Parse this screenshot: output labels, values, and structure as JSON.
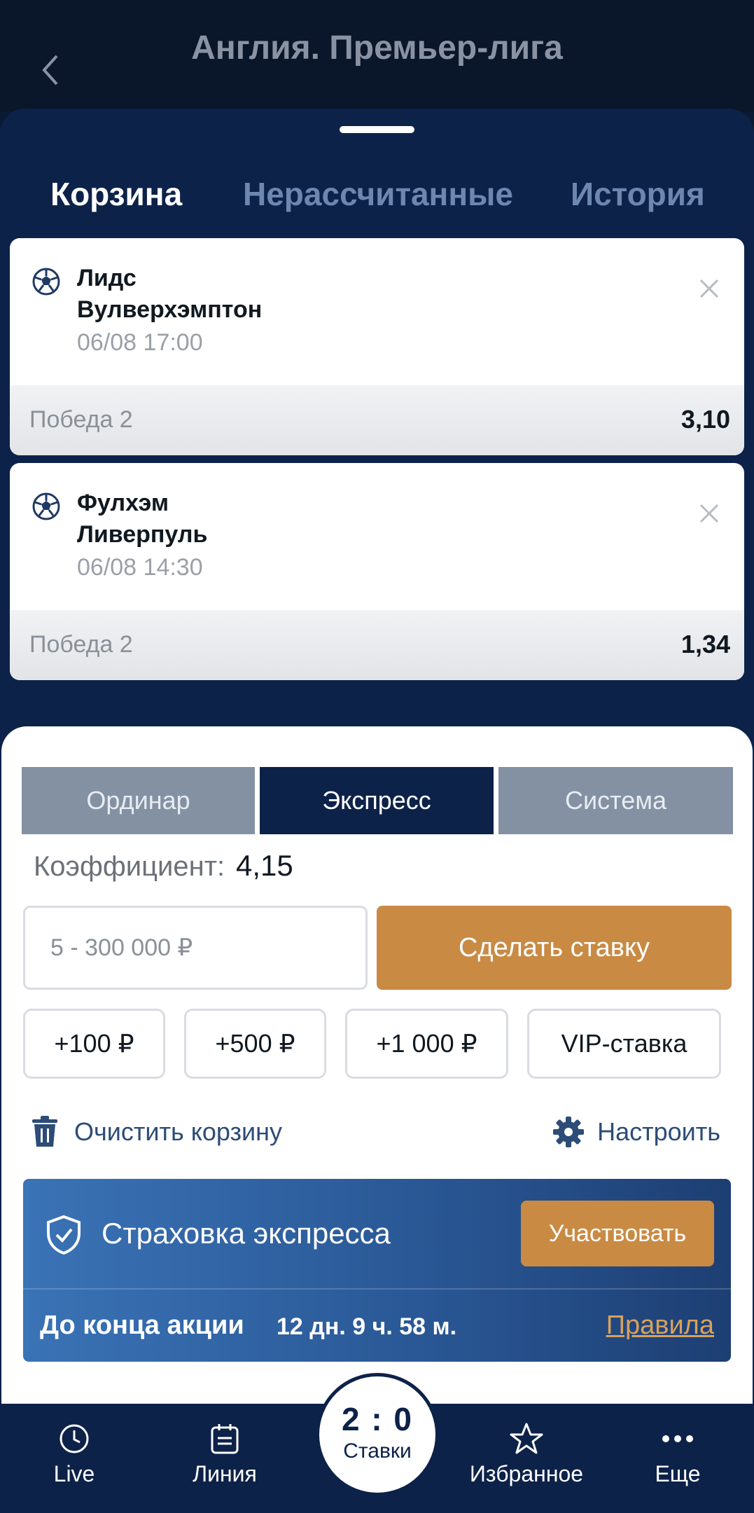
{
  "header": {
    "title": "Англия. Премьер-лига"
  },
  "tabs": [
    {
      "label": "Корзина",
      "active": true
    },
    {
      "label": "Нерассчитанные",
      "active": false
    },
    {
      "label": "История",
      "active": false
    }
  ],
  "bets": [
    {
      "team1": "Лидс",
      "team2": "Вулверхэмптон",
      "datetime": "06/08 17:00",
      "outcome": "Победа 2",
      "odds": "3,10"
    },
    {
      "team1": "Фулхэм",
      "team2": "Ливерпуль",
      "datetime": "06/08 14:30",
      "outcome": "Победа 2",
      "odds": "1,34"
    }
  ],
  "bet_types": [
    {
      "label": "Ординар",
      "active": false
    },
    {
      "label": "Экспресс",
      "active": true
    },
    {
      "label": "Система",
      "active": false
    }
  ],
  "coefficient": {
    "label": "Коэффициент:",
    "value": "4,15"
  },
  "stake": {
    "placeholder": "5 - 300 000 ₽",
    "submit_label": "Сделать ставку"
  },
  "quick_amounts": [
    "+100 ₽",
    "+500 ₽",
    "+1 000 ₽",
    "VIP-ставка"
  ],
  "actions": {
    "clear_label": "Очистить корзину",
    "configure_label": "Настроить"
  },
  "promo": {
    "title": "Страховка экспресса",
    "join_label": "Участвовать",
    "until_label": "До конца акции",
    "timer": "12 дн. 9 ч. 58 м.",
    "rules_label": "Правила"
  },
  "nav": {
    "items": [
      {
        "label": "Live",
        "icon": "clock-icon"
      },
      {
        "label": "Линия",
        "icon": "calendar-list-icon"
      },
      {
        "label": "Избранное",
        "icon": "star-icon"
      },
      {
        "label": "Еще",
        "icon": "more-dots-icon"
      }
    ],
    "center": {
      "score": "2 : 0",
      "label": "Ставки"
    }
  },
  "colors": {
    "navy": "#0d2249",
    "accent_orange": "#c98a43",
    "segment_inactive": "#8391a3",
    "link_blue": "#2d4c77"
  }
}
